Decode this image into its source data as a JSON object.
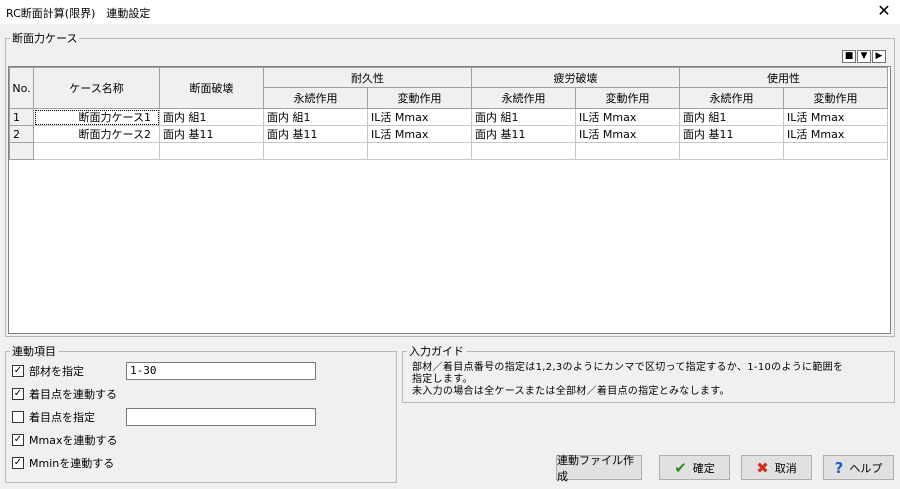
{
  "window": {
    "title": "RC断面計算(限界)　連動設定",
    "close_glyph": "✕"
  },
  "case_group": {
    "legend": "断面力ケース",
    "grid_buttons": [
      "■",
      "▼",
      "▶"
    ],
    "headers": {
      "no": "No.",
      "case_name": "ケース名称",
      "section_failure": "断面破壊",
      "durability": "耐久性",
      "fatigue": "疲労破壊",
      "serviceability": "使用性",
      "permanent": "永続作用",
      "variable": "変動作用"
    },
    "rows": [
      {
        "no": "1",
        "name": "断面力ケース1",
        "sf": "面内 組1",
        "d_perm": "面内 組1",
        "d_var": "IL活 Mmax",
        "f_perm": "面内 組1",
        "f_var": "IL活 Mmax",
        "s_perm": "面内 組1",
        "s_var": "IL活 Mmax"
      },
      {
        "no": "2",
        "name": "断面力ケース2",
        "sf": "面内 基11",
        "d_perm": "面内 基11",
        "d_var": "IL活 Mmax",
        "f_perm": "面内 基11",
        "f_var": "IL活 Mmax",
        "s_perm": "面内 基11",
        "s_var": "IL活 Mmax"
      }
    ]
  },
  "link_group": {
    "legend": "連動項目",
    "member_label": "部材を指定",
    "member_value": "1-30",
    "link_points_label": "着目点を連動する",
    "point_label": "着目点を指定",
    "point_value": "",
    "mmax_label": "Mmaxを連動する",
    "mmin_label": "Mminを連動する",
    "check_glyph": "✓"
  },
  "guide": {
    "legend": "入力ガイド",
    "line1": "部材／着目点番号の指定は1,2,3のようにカンマで区切って指定するか、1-10のように範囲を",
    "line2": "指定します。",
    "line3": "未入力の場合は全ケースまたは全部材／着目点の指定とみなします。"
  },
  "buttons": {
    "create": "連動ファイル作成",
    "ok": "確定",
    "ok_icon": "✔",
    "cancel": "取消",
    "cancel_icon": "✖",
    "help": "ヘルプ",
    "help_icon": "?"
  },
  "colors": {
    "ok_icon": "#2e8b2e",
    "cancel_icon": "#d03020",
    "help_icon": "#1f5fbf"
  }
}
